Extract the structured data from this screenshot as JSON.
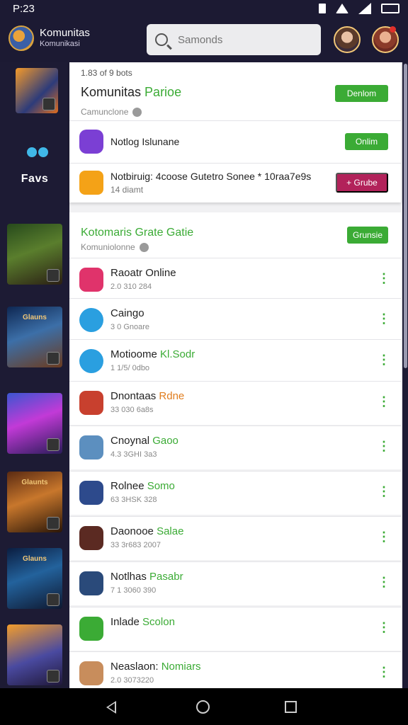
{
  "status_bar": {
    "time": "P:23"
  },
  "header": {
    "title": "Komunitas",
    "subtitle": "Komunikasi",
    "search_placeholder": "Samonds"
  },
  "sidebar": {
    "favorites_label": "Favs",
    "thumb_banners": [
      "",
      "",
      "Glauns",
      "",
      "Glaunts",
      "Glauns",
      ""
    ]
  },
  "top_card": {
    "caption": "1.83 of 9 bots",
    "heading_prefix": "Komunitas ",
    "heading_accent": "Parioe",
    "sub": "Camunclone",
    "follow_label": "Denlom",
    "rows": [
      {
        "title": "Notlog Islunane",
        "sub": "",
        "button": "Onlim",
        "color": "#7b3fd4"
      },
      {
        "title": "Notbiruig: 4coose Gutetro Sonee * 10raa7e9s",
        "sub": "14 diamt",
        "button": "+ Grube",
        "color": "#f4a217"
      }
    ]
  },
  "section": {
    "title": "Kotomaris Grate Gatie",
    "sub": "Komuniolonne",
    "button": "Grunsie"
  },
  "list": [
    {
      "name": "Raoatr Online",
      "accent": "",
      "meta": "2.0 310 284",
      "color": "#e0336b",
      "shape": "round"
    },
    {
      "name": "Caingo",
      "accent": "",
      "meta": "3 0 Gnoare",
      "color": "#2a9fe0",
      "shape": "circle"
    },
    {
      "name": "Motioome ",
      "accent": "Kl.Sodr",
      "meta": "1 1/5/ 0dbo",
      "color": "#2a9fe0",
      "shape": "circle"
    },
    {
      "name": "Dnontaas ",
      "accent": "Rdne",
      "meta": "33 030 6a8s",
      "color": "#c8402e",
      "shape": "round",
      "accentColor": "orange"
    },
    {
      "name": "Cnoynal ",
      "accent": "Gaoo",
      "meta": "4.3 3GHI 3a3",
      "color": "#5c8fbf",
      "shape": "round"
    },
    {
      "name": "Rolnee ",
      "accent": "Somo",
      "meta": "63 3HSK 328",
      "color": "#2d4a8c",
      "shape": "round"
    },
    {
      "name": "Daonooe ",
      "accent": "Salae",
      "meta": "33 3r683 2007",
      "color": "#5b2a22",
      "shape": "round"
    },
    {
      "name": "Notlhas ",
      "accent": "Pasabr",
      "meta": "7 1 3060 390",
      "color": "#2a4a7a",
      "shape": "round"
    },
    {
      "name": "Inlade ",
      "accent": "Scolon",
      "meta": "",
      "color": "#3bab35",
      "shape": "round"
    },
    {
      "name": "Neaslaon: ",
      "accent": "Nomiars",
      "meta": "2.0 3073220",
      "color": "#c88d5c",
      "shape": "round"
    }
  ]
}
